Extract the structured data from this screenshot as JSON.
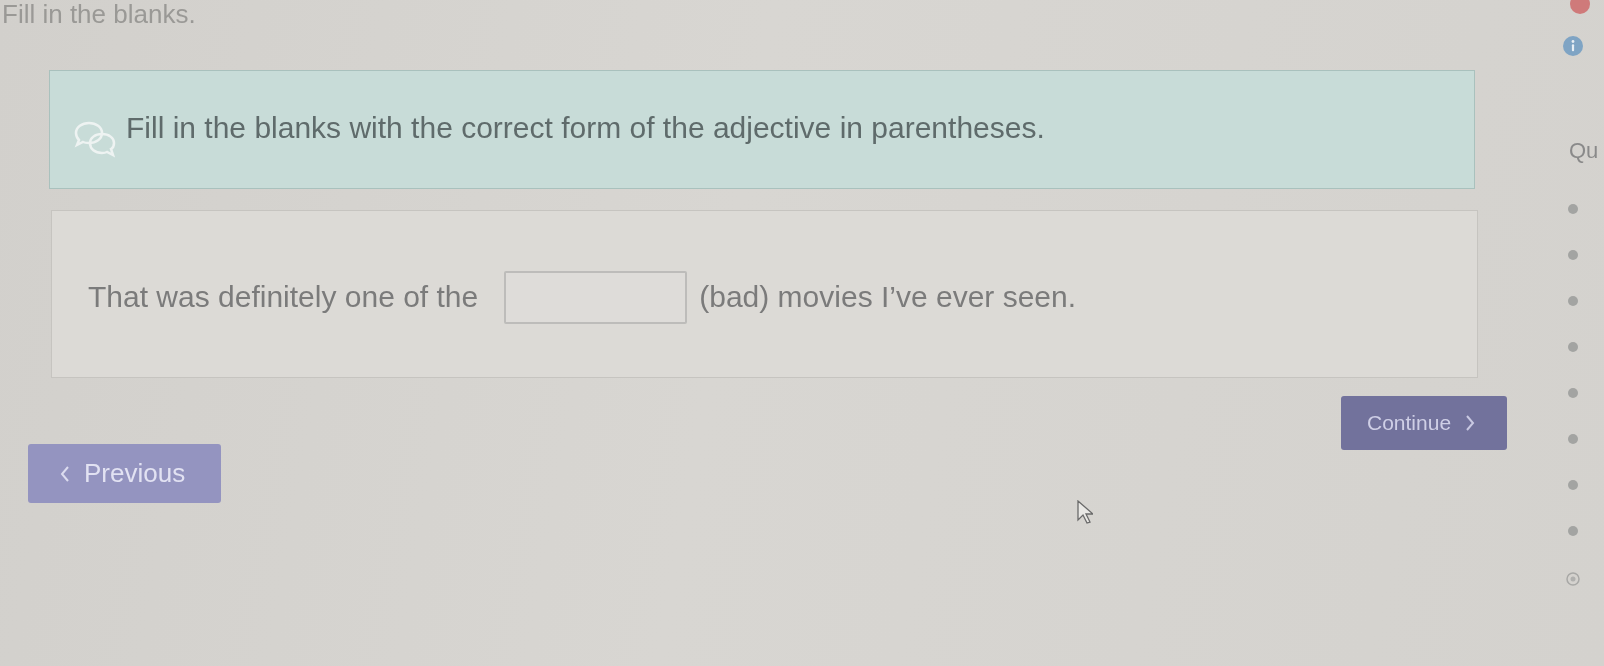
{
  "header": {
    "title": "Fill in the blanks."
  },
  "instruction": {
    "text": "Fill in the blanks with the correct form of the adjective in parentheses."
  },
  "question": {
    "parts": [
      {
        "kind": "text",
        "text": "That was definitely one of the"
      },
      {
        "kind": "blank"
      },
      {
        "kind": "text",
        "text": "(bad) movies I’ve ever seen."
      }
    ]
  },
  "buttons": [
    {
      "kind": "continue",
      "label": "Continue"
    },
    {
      "kind": "previous",
      "label": "Previous"
    }
  ],
  "sidebar": {
    "title": "Qu",
    "items": [
      {
        "kind": "dot"
      },
      {
        "kind": "dot"
      },
      {
        "kind": "dot"
      },
      {
        "kind": "dot"
      },
      {
        "kind": "dot"
      },
      {
        "kind": "dot"
      },
      {
        "kind": "dot"
      },
      {
        "kind": "dot"
      },
      {
        "kind": "ring"
      }
    ]
  }
}
